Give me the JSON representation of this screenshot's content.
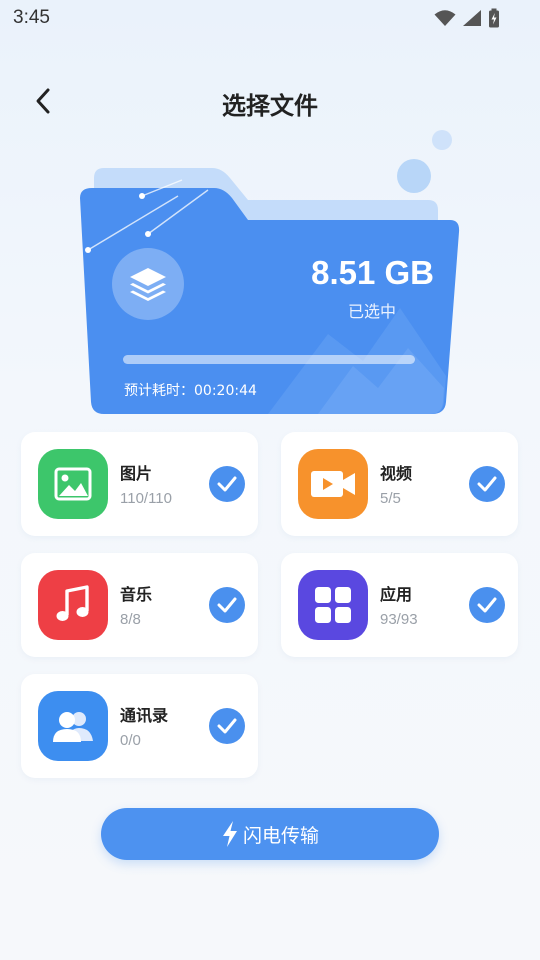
{
  "status_bar": {
    "time": "3:45"
  },
  "header": {
    "title": "选择文件"
  },
  "summary": {
    "selected_size": "8.51 GB",
    "selected_label": "已选中",
    "eta_label": "预计耗时：",
    "eta_value": "00:20:44",
    "progress": 0
  },
  "categories": [
    {
      "name": "图片",
      "count": "110/110",
      "icon": "image-icon",
      "color": "#3dc66b",
      "checked": true
    },
    {
      "name": "视频",
      "count": "5/5",
      "icon": "video-icon",
      "color": "#f7922c",
      "checked": true
    },
    {
      "name": "音乐",
      "count": "8/8",
      "icon": "music-icon",
      "color": "#ee3f45",
      "checked": true
    },
    {
      "name": "应用",
      "count": "93/93",
      "icon": "apps-icon",
      "color": "#5a48e0",
      "checked": true
    },
    {
      "name": "通讯录",
      "count": "0/0",
      "icon": "contacts-icon",
      "color": "#3d8ef0",
      "checked": true
    }
  ],
  "action": {
    "transfer_label": "闪电传输",
    "icon": "lightning-icon"
  },
  "colors": {
    "accent": "#4a90ee",
    "folder": "#4b8ff0"
  }
}
